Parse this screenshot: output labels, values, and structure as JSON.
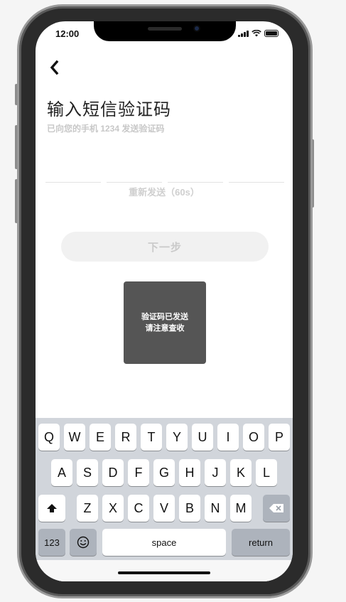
{
  "status": {
    "time": "12:00"
  },
  "header": {
    "title": "输入短信验证码",
    "subtitle": "已向您的手机 1234 发送验证码"
  },
  "resend_label": "重新发送（60s）",
  "next_label": "下一步",
  "toast": {
    "line1": "验证码已发送",
    "line2": "请注意查收"
  },
  "keyboard": {
    "row1": [
      "Q",
      "W",
      "E",
      "R",
      "T",
      "Y",
      "U",
      "I",
      "O",
      "P"
    ],
    "row2": [
      "A",
      "S",
      "D",
      "F",
      "G",
      "H",
      "J",
      "K",
      "L"
    ],
    "row3": [
      "Z",
      "X",
      "C",
      "V",
      "B",
      "N",
      "M"
    ],
    "numbers_label": "123",
    "space_label": "space",
    "return_label": "return"
  }
}
